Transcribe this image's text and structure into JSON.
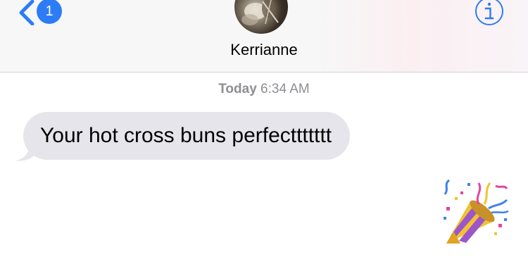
{
  "header": {
    "unread_count": "1",
    "contact_name": "Kerrianne",
    "info_icon": "info-icon",
    "back_icon": "chevron-left-icon"
  },
  "conversation": {
    "timestamp_day": "Today",
    "timestamp_time": "6:34 AM",
    "messages": [
      {
        "direction": "incoming",
        "text": "Your hot cross buns perfecttttttt"
      }
    ],
    "reaction_emoji": "party-popper-icon"
  },
  "colors": {
    "accent": "#2d7cf6",
    "bubble_incoming": "#e6e5eb",
    "timestamp": "#8e8e93",
    "header_bg": "#f7f7f7"
  }
}
